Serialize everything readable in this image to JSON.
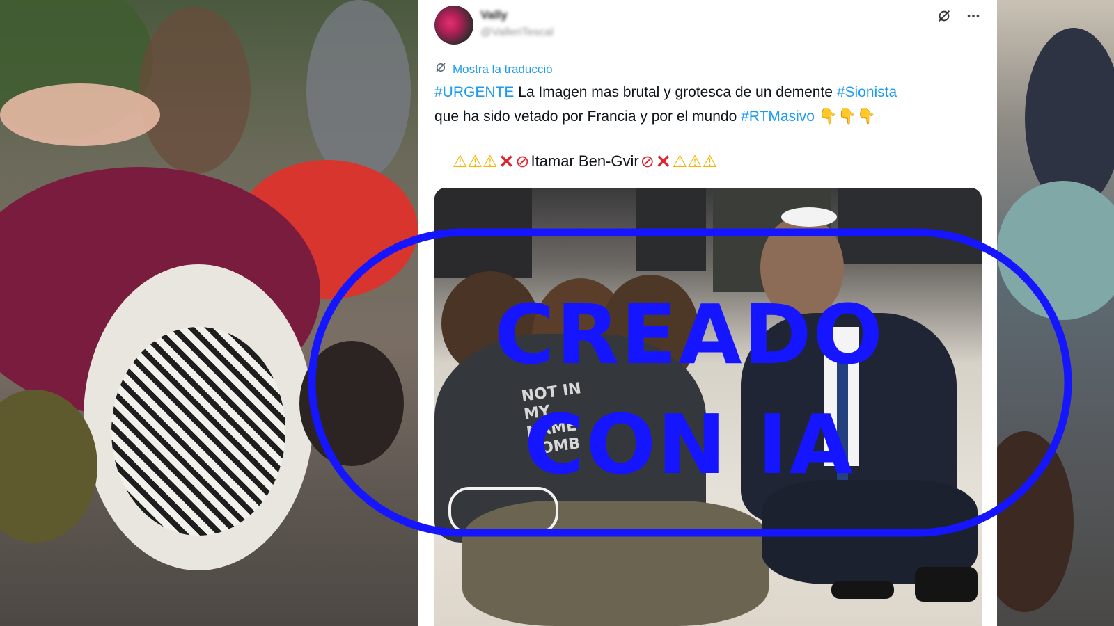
{
  "tweet": {
    "author_name": "Vally",
    "author_handle": "@ValleriTescal",
    "translate_label": "Mostra la traducció",
    "line1_tag": "#URGENTE",
    "line1_text": " La Imagen mas brutal y grotesca de un demente ",
    "line1_tag2": "#Sionista",
    "line2_text": "que ha sido vetado por Francia y por el mundo ",
    "line2_tag": "#RTMasivo",
    "emoji_name": "Itamar Ben-Gvir",
    "shirt_text": "NOT IN MY NAME BOMB"
  },
  "icons": {
    "grok": "grok-icon",
    "more": "more-icon",
    "translate": "translate-icon",
    "warning": "warning-icon",
    "cross": "cross-mark-icon",
    "prohibited": "prohibited-icon",
    "pointing": "pointing-down-icon"
  },
  "overlay": {
    "line1": "CREADO",
    "line2": "CON IA",
    "color": "#1515ff"
  }
}
